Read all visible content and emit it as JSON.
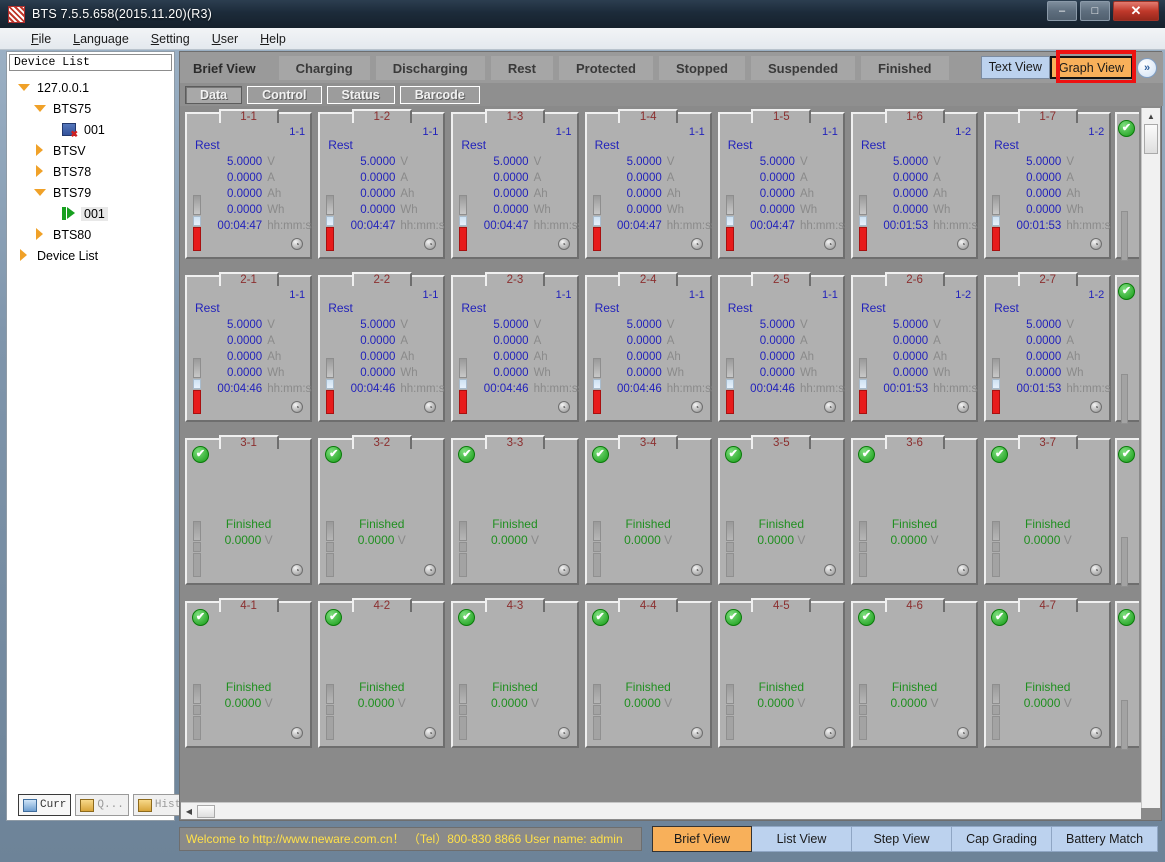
{
  "window": {
    "title": "BTS 7.5.5.658(2015.11.20)(R3)",
    "app_icon": "bts-logo-icon",
    "buttons": {
      "minimize": "–",
      "maximize": "□",
      "close": "✕"
    }
  },
  "menu": {
    "items": [
      "File",
      "Language",
      "Setting",
      "User",
      "Help"
    ]
  },
  "tree": {
    "header": "Device List",
    "nodes": [
      {
        "label": "127.0.0.1",
        "indent": 0,
        "twisty": "open",
        "icon": "none",
        "selected": false
      },
      {
        "label": "BTS75",
        "indent": 1,
        "twisty": "open",
        "icon": "none",
        "selected": false
      },
      {
        "label": "001",
        "indent": 2,
        "twisty": "none",
        "icon": "device-offline-icon",
        "selected": false
      },
      {
        "label": "BTSV",
        "indent": 1,
        "twisty": "closed",
        "icon": "none",
        "selected": false
      },
      {
        "label": "BTS78",
        "indent": 1,
        "twisty": "closed",
        "icon": "none",
        "selected": false
      },
      {
        "label": "BTS79",
        "indent": 1,
        "twisty": "open",
        "icon": "none",
        "selected": false
      },
      {
        "label": "001",
        "indent": 2,
        "twisty": "none",
        "icon": "device-online-icon",
        "selected": true
      },
      {
        "label": "BTS80",
        "indent": 1,
        "twisty": "closed",
        "icon": "none",
        "selected": false
      },
      {
        "label": "Device List",
        "indent": 0,
        "twisty": "closed",
        "icon": "none",
        "selected": false
      }
    ],
    "tools": [
      {
        "label": "Curr",
        "icon": "current-data-icon",
        "state": "active"
      },
      {
        "label": "Q...",
        "icon": "query-icon",
        "state": "disabled"
      },
      {
        "label": "Hist",
        "icon": "history-icon",
        "state": "disabled"
      }
    ]
  },
  "status_tabs": [
    {
      "label": "Brief View",
      "active": true
    },
    {
      "label": "Charging",
      "active": false
    },
    {
      "label": "Discharging",
      "active": false
    },
    {
      "label": "Rest",
      "active": false
    },
    {
      "label": "Protected",
      "active": false
    },
    {
      "label": "Stopped",
      "active": false
    },
    {
      "label": "Suspended",
      "active": false
    },
    {
      "label": "Finished",
      "active": false
    }
  ],
  "view_buttons": {
    "text_view": "Text View",
    "graph_view": "Graph View",
    "graph_view_highlighted": true,
    "expand_icon": "»",
    "highlight_color": "#ee1111",
    "active_color": "#f8b05a"
  },
  "sub_tabs": [
    {
      "label": "Data",
      "active": true
    },
    {
      "label": "Control",
      "active": false
    },
    {
      "label": "Status",
      "active": false
    },
    {
      "label": "Barcode",
      "active": false
    }
  ],
  "grid": {
    "units": [
      "V",
      "A",
      "Ah",
      "Wh",
      "hh:mm:ss"
    ],
    "rows": [
      {
        "cells": [
          {
            "tab": "1-1",
            "badge": "1-1",
            "status": "Rest",
            "type": "rest",
            "values": [
              "5.0000",
              "0.0000",
              "0.0000",
              "0.0000",
              "00:04:47"
            ]
          },
          {
            "tab": "1-2",
            "badge": "1-1",
            "status": "Rest",
            "type": "rest",
            "values": [
              "5.0000",
              "0.0000",
              "0.0000",
              "0.0000",
              "00:04:47"
            ]
          },
          {
            "tab": "1-3",
            "badge": "1-1",
            "status": "Rest",
            "type": "rest",
            "values": [
              "5.0000",
              "0.0000",
              "0.0000",
              "0.0000",
              "00:04:47"
            ]
          },
          {
            "tab": "1-4",
            "badge": "1-1",
            "status": "Rest",
            "type": "rest",
            "values": [
              "5.0000",
              "0.0000",
              "0.0000",
              "0.0000",
              "00:04:47"
            ]
          },
          {
            "tab": "1-5",
            "badge": "1-1",
            "status": "Rest",
            "type": "rest",
            "values": [
              "5.0000",
              "0.0000",
              "0.0000",
              "0.0000",
              "00:04:47"
            ]
          },
          {
            "tab": "1-6",
            "badge": "1-2",
            "status": "Rest",
            "type": "rest",
            "values": [
              "5.0000",
              "0.0000",
              "0.0000",
              "0.0000",
              "00:01:53"
            ]
          },
          {
            "tab": "1-7",
            "badge": "1-2",
            "status": "Rest",
            "type": "rest",
            "values": [
              "5.0000",
              "0.0000",
              "0.0000",
              "0.0000",
              "00:01:53"
            ]
          }
        ]
      },
      {
        "cells": [
          {
            "tab": "2-1",
            "badge": "1-1",
            "status": "Rest",
            "type": "rest",
            "values": [
              "5.0000",
              "0.0000",
              "0.0000",
              "0.0000",
              "00:04:46"
            ]
          },
          {
            "tab": "2-2",
            "badge": "1-1",
            "status": "Rest",
            "type": "rest",
            "values": [
              "5.0000",
              "0.0000",
              "0.0000",
              "0.0000",
              "00:04:46"
            ]
          },
          {
            "tab": "2-3",
            "badge": "1-1",
            "status": "Rest",
            "type": "rest",
            "values": [
              "5.0000",
              "0.0000",
              "0.0000",
              "0.0000",
              "00:04:46"
            ]
          },
          {
            "tab": "2-4",
            "badge": "1-1",
            "status": "Rest",
            "type": "rest",
            "values": [
              "5.0000",
              "0.0000",
              "0.0000",
              "0.0000",
              "00:04:46"
            ]
          },
          {
            "tab": "2-5",
            "badge": "1-1",
            "status": "Rest",
            "type": "rest",
            "values": [
              "5.0000",
              "0.0000",
              "0.0000",
              "0.0000",
              "00:04:46"
            ]
          },
          {
            "tab": "2-6",
            "badge": "1-2",
            "status": "Rest",
            "type": "rest",
            "values": [
              "5.0000",
              "0.0000",
              "0.0000",
              "0.0000",
              "00:01:53"
            ]
          },
          {
            "tab": "2-7",
            "badge": "1-2",
            "status": "Rest",
            "type": "rest",
            "values": [
              "5.0000",
              "0.0000",
              "0.0000",
              "0.0000",
              "00:01:53"
            ]
          }
        ]
      },
      {
        "cells": [
          {
            "tab": "3-1",
            "badge": "",
            "status": "Finished",
            "type": "finished",
            "voltage": "0.0000",
            "unit": "V"
          },
          {
            "tab": "3-2",
            "badge": "",
            "status": "Finished",
            "type": "finished",
            "voltage": "0.0000",
            "unit": "V"
          },
          {
            "tab": "3-3",
            "badge": "",
            "status": "Finished",
            "type": "finished",
            "voltage": "0.0000",
            "unit": "V"
          },
          {
            "tab": "3-4",
            "badge": "",
            "status": "Finished",
            "type": "finished",
            "voltage": "0.0000",
            "unit": "V"
          },
          {
            "tab": "3-5",
            "badge": "",
            "status": "Finished",
            "type": "finished",
            "voltage": "0.0000",
            "unit": "V"
          },
          {
            "tab": "3-6",
            "badge": "",
            "status": "Finished",
            "type": "finished",
            "voltage": "0.0000",
            "unit": "V"
          },
          {
            "tab": "3-7",
            "badge": "",
            "status": "Finished",
            "type": "finished",
            "voltage": "0.0000",
            "unit": "V"
          }
        ]
      },
      {
        "cells": [
          {
            "tab": "4-1",
            "badge": "",
            "status": "Finished",
            "type": "finished",
            "voltage": "0.0000",
            "unit": "V"
          },
          {
            "tab": "4-2",
            "badge": "",
            "status": "Finished",
            "type": "finished",
            "voltage": "0.0000",
            "unit": "V"
          },
          {
            "tab": "4-3",
            "badge": "",
            "status": "Finished",
            "type": "finished",
            "voltage": "0.0000",
            "unit": "V"
          },
          {
            "tab": "4-4",
            "badge": "",
            "status": "Finished",
            "type": "finished",
            "voltage": "0.0000",
            "unit": "V"
          },
          {
            "tab": "4-5",
            "badge": "",
            "status": "Finished",
            "type": "finished",
            "voltage": "0.0000",
            "unit": "V"
          },
          {
            "tab": "4-6",
            "badge": "",
            "status": "Finished",
            "type": "finished",
            "voltage": "0.0000",
            "unit": "V"
          },
          {
            "tab": "4-7",
            "badge": "",
            "status": "Finished",
            "type": "finished",
            "voltage": "0.0000",
            "unit": "V"
          }
        ]
      }
    ],
    "check_icon": "✔"
  },
  "status_bar": {
    "message": "Welcome to http://www.neware.com.cn！  （Tel）800-830 8866  User name: admin",
    "text_color": "#ffe04a"
  },
  "bottom_tabs": [
    {
      "label": "Brief View",
      "active": true
    },
    {
      "label": "List View",
      "active": false
    },
    {
      "label": "Step View",
      "active": false
    },
    {
      "label": "Cap Grading",
      "active": false
    },
    {
      "label": "Battery Match",
      "active": false
    }
  ],
  "scrollbars": {
    "vertical_up_arrow": "▲",
    "horizontal_left_arrow": "◀"
  }
}
